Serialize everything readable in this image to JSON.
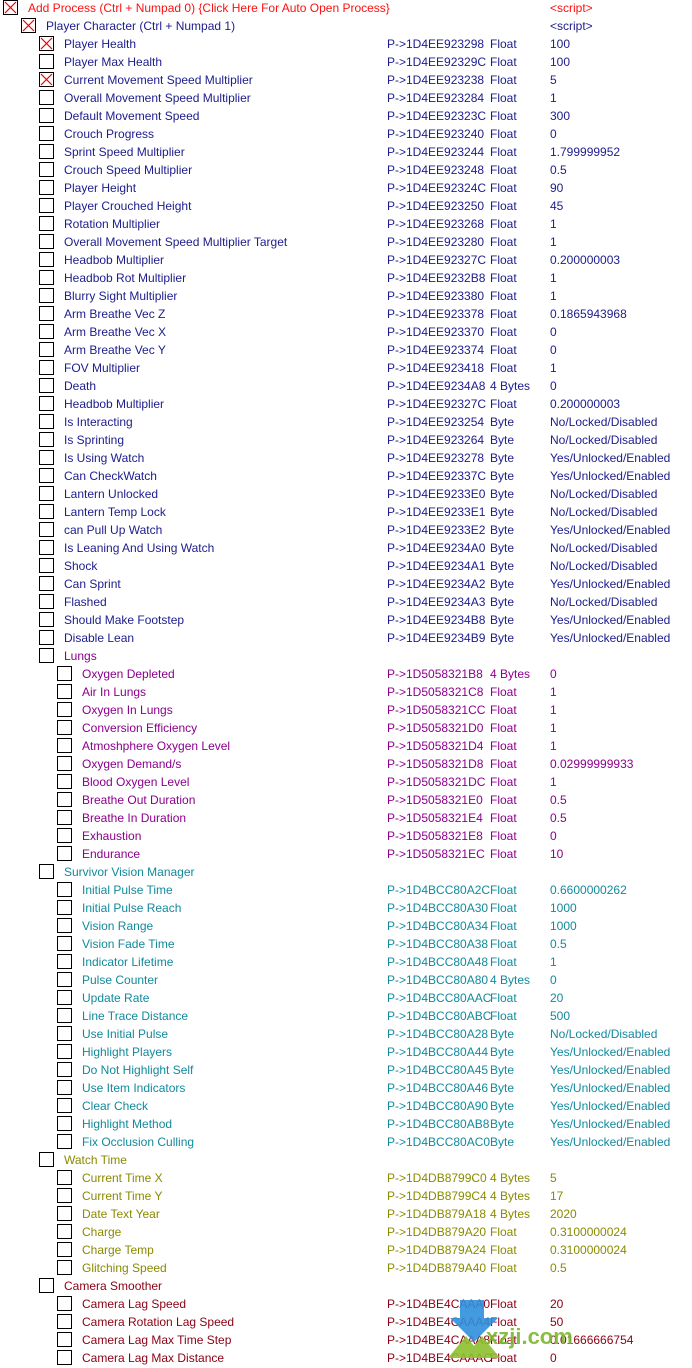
{
  "colors": {
    "red": "#ff1010",
    "navy": "#1c1c8c",
    "purple": "#8c008c",
    "teal": "#128a9c",
    "olive": "#8a8a00",
    "darkred": "#8b0014"
  },
  "rows": [
    {
      "l": 0,
      "c": true,
      "g": "red",
      "name": "Add Process (Ctrl + Numpad 0) {Click Here For Auto Open Process}",
      "addr": "",
      "type": "",
      "value": "<script>"
    },
    {
      "l": 1,
      "c": true,
      "g": "navy",
      "name": "Player Character (Ctrl + Numpad 1)",
      "addr": "",
      "type": "",
      "value": "<script>"
    },
    {
      "l": 2,
      "c": true,
      "g": "navy",
      "name": "Player Health",
      "addr": "P->1D4EE923298",
      "type": "Float",
      "value": "100"
    },
    {
      "l": 2,
      "c": false,
      "g": "navy",
      "name": "Player Max Health",
      "addr": "P->1D4EE92329C",
      "type": "Float",
      "value": "100"
    },
    {
      "l": 2,
      "c": true,
      "g": "navy",
      "name": "Current Movement Speed Multiplier",
      "addr": "P->1D4EE923238",
      "type": "Float",
      "value": "5"
    },
    {
      "l": 2,
      "c": false,
      "g": "navy",
      "name": "Overall Movement Speed Multiplier",
      "addr": "P->1D4EE923284",
      "type": "Float",
      "value": "1"
    },
    {
      "l": 2,
      "c": false,
      "g": "navy",
      "name": "Default Movement Speed",
      "addr": "P->1D4EE92323C",
      "type": "Float",
      "value": "300"
    },
    {
      "l": 2,
      "c": false,
      "g": "navy",
      "name": "Crouch Progress",
      "addr": "P->1D4EE923240",
      "type": "Float",
      "value": "0"
    },
    {
      "l": 2,
      "c": false,
      "g": "navy",
      "name": "Sprint Speed Multiplier",
      "addr": "P->1D4EE923244",
      "type": "Float",
      "value": "1.799999952"
    },
    {
      "l": 2,
      "c": false,
      "g": "navy",
      "name": "Crouch Speed Multiplier",
      "addr": "P->1D4EE923248",
      "type": "Float",
      "value": "0.5"
    },
    {
      "l": 2,
      "c": false,
      "g": "navy",
      "name": "Player Height",
      "addr": "P->1D4EE92324C",
      "type": "Float",
      "value": "90"
    },
    {
      "l": 2,
      "c": false,
      "g": "navy",
      "name": "Player Crouched Height",
      "addr": "P->1D4EE923250",
      "type": "Float",
      "value": "45"
    },
    {
      "l": 2,
      "c": false,
      "g": "navy",
      "name": "Rotation Multiplier",
      "addr": "P->1D4EE923268",
      "type": "Float",
      "value": "1"
    },
    {
      "l": 2,
      "c": false,
      "g": "navy",
      "name": "Overall Movement Speed Multiplier Target",
      "addr": "P->1D4EE923280",
      "type": "Float",
      "value": "1"
    },
    {
      "l": 2,
      "c": false,
      "g": "navy",
      "name": "Headbob Multiplier",
      "addr": "P->1D4EE92327C",
      "type": "Float",
      "value": "0.200000003"
    },
    {
      "l": 2,
      "c": false,
      "g": "navy",
      "name": "Headbob Rot Multiplier",
      "addr": "P->1D4EE9232B8",
      "type": "Float",
      "value": "1"
    },
    {
      "l": 2,
      "c": false,
      "g": "navy",
      "name": "Blurry Sight Multiplier",
      "addr": "P->1D4EE923380",
      "type": "Float",
      "value": "1"
    },
    {
      "l": 2,
      "c": false,
      "g": "navy",
      "name": "Arm Breathe Vec Z",
      "addr": "P->1D4EE923378",
      "type": "Float",
      "value": "0.1865943968"
    },
    {
      "l": 2,
      "c": false,
      "g": "navy",
      "name": "Arm Breathe Vec X",
      "addr": "P->1D4EE923370",
      "type": "Float",
      "value": "0"
    },
    {
      "l": 2,
      "c": false,
      "g": "navy",
      "name": "Arm Breathe Vec Y",
      "addr": "P->1D4EE923374",
      "type": "Float",
      "value": "0"
    },
    {
      "l": 2,
      "c": false,
      "g": "navy",
      "name": "FOV Multiplier",
      "addr": "P->1D4EE923418",
      "type": "Float",
      "value": "1"
    },
    {
      "l": 2,
      "c": false,
      "g": "navy",
      "name": "Death",
      "addr": "P->1D4EE9234A8",
      "type": "4 Bytes",
      "value": "0"
    },
    {
      "l": 2,
      "c": false,
      "g": "navy",
      "name": "Headbob Multiplier",
      "addr": "P->1D4EE92327C",
      "type": "Float",
      "value": "0.200000003"
    },
    {
      "l": 2,
      "c": false,
      "g": "navy",
      "name": "Is Interacting",
      "addr": "P->1D4EE923254",
      "type": "Byte",
      "value": "No/Locked/Disabled"
    },
    {
      "l": 2,
      "c": false,
      "g": "navy",
      "name": "Is Sprinting",
      "addr": "P->1D4EE923264",
      "type": "Byte",
      "value": "No/Locked/Disabled"
    },
    {
      "l": 2,
      "c": false,
      "g": "navy",
      "name": "Is Using Watch",
      "addr": "P->1D4EE923278",
      "type": "Byte",
      "value": "Yes/Unlocked/Enabled"
    },
    {
      "l": 2,
      "c": false,
      "g": "navy",
      "name": "Can CheckWatch",
      "addr": "P->1D4EE92337C",
      "type": "Byte",
      "value": "Yes/Unlocked/Enabled"
    },
    {
      "l": 2,
      "c": false,
      "g": "navy",
      "name": "Lantern Unlocked",
      "addr": "P->1D4EE9233E0",
      "type": "Byte",
      "value": "No/Locked/Disabled"
    },
    {
      "l": 2,
      "c": false,
      "g": "navy",
      "name": "Lantern Temp Lock",
      "addr": "P->1D4EE9233E1",
      "type": "Byte",
      "value": "No/Locked/Disabled"
    },
    {
      "l": 2,
      "c": false,
      "g": "navy",
      "name": "can Pull Up Watch",
      "addr": "P->1D4EE9233E2",
      "type": "Byte",
      "value": "Yes/Unlocked/Enabled"
    },
    {
      "l": 2,
      "c": false,
      "g": "navy",
      "name": "Is Leaning And Using Watch",
      "addr": "P->1D4EE9234A0",
      "type": "Byte",
      "value": "No/Locked/Disabled"
    },
    {
      "l": 2,
      "c": false,
      "g": "navy",
      "name": "Shock",
      "addr": "P->1D4EE9234A1",
      "type": "Byte",
      "value": "No/Locked/Disabled"
    },
    {
      "l": 2,
      "c": false,
      "g": "navy",
      "name": "Can Sprint",
      "addr": "P->1D4EE9234A2",
      "type": "Byte",
      "value": "Yes/Unlocked/Enabled"
    },
    {
      "l": 2,
      "c": false,
      "g": "navy",
      "name": "Flashed",
      "addr": "P->1D4EE9234A3",
      "type": "Byte",
      "value": "No/Locked/Disabled"
    },
    {
      "l": 2,
      "c": false,
      "g": "navy",
      "name": "Should Make Footstep",
      "addr": "P->1D4EE9234B8",
      "type": "Byte",
      "value": "Yes/Unlocked/Enabled"
    },
    {
      "l": 2,
      "c": false,
      "g": "navy",
      "name": "Disable Lean",
      "addr": "P->1D4EE9234B9",
      "type": "Byte",
      "value": "Yes/Unlocked/Enabled"
    },
    {
      "l": 2,
      "c": false,
      "g": "purple",
      "name": "Lungs",
      "addr": "",
      "type": "",
      "value": ""
    },
    {
      "l": 3,
      "c": false,
      "g": "purple",
      "name": "Oxygen Depleted",
      "addr": "P->1D5058321B8",
      "type": "4 Bytes",
      "value": "0"
    },
    {
      "l": 3,
      "c": false,
      "g": "purple",
      "name": "Air In Lungs",
      "addr": "P->1D5058321C8",
      "type": "Float",
      "value": "1"
    },
    {
      "l": 3,
      "c": false,
      "g": "purple",
      "name": "Oxygen In Lungs",
      "addr": "P->1D5058321CC",
      "type": "Float",
      "value": "1"
    },
    {
      "l": 3,
      "c": false,
      "g": "purple",
      "name": "Conversion Efficiency",
      "addr": "P->1D5058321D0",
      "type": "Float",
      "value": "1"
    },
    {
      "l": 3,
      "c": false,
      "g": "purple",
      "name": "Atmoshphere Oxygen Level",
      "addr": "P->1D5058321D4",
      "type": "Float",
      "value": "1"
    },
    {
      "l": 3,
      "c": false,
      "g": "purple",
      "name": "Oxygen Demand/s",
      "addr": "P->1D5058321D8",
      "type": "Float",
      "value": "0.02999999933"
    },
    {
      "l": 3,
      "c": false,
      "g": "purple",
      "name": "Blood Oxygen Level",
      "addr": "P->1D5058321DC",
      "type": "Float",
      "value": "1"
    },
    {
      "l": 3,
      "c": false,
      "g": "purple",
      "name": "Breathe Out Duration",
      "addr": "P->1D5058321E0",
      "type": "Float",
      "value": "0.5"
    },
    {
      "l": 3,
      "c": false,
      "g": "purple",
      "name": "Breathe In Duration",
      "addr": "P->1D5058321E4",
      "type": "Float",
      "value": "0.5"
    },
    {
      "l": 3,
      "c": false,
      "g": "purple",
      "name": "Exhaustion",
      "addr": "P->1D5058321E8",
      "type": "Float",
      "value": "0"
    },
    {
      "l": 3,
      "c": false,
      "g": "purple",
      "name": "Endurance",
      "addr": "P->1D5058321EC",
      "type": "Float",
      "value": "10"
    },
    {
      "l": 2,
      "c": false,
      "g": "teal",
      "name": "Survivor Vision Manager",
      "addr": "",
      "type": "",
      "value": ""
    },
    {
      "l": 3,
      "c": false,
      "g": "teal",
      "name": "Initial Pulse Time",
      "addr": "P->1D4BCC80A2C",
      "type": "Float",
      "value": "0.6600000262"
    },
    {
      "l": 3,
      "c": false,
      "g": "teal",
      "name": "Initial Pulse Reach",
      "addr": "P->1D4BCC80A30",
      "type": "Float",
      "value": "1000"
    },
    {
      "l": 3,
      "c": false,
      "g": "teal",
      "name": "Vision Range",
      "addr": "P->1D4BCC80A34",
      "type": "Float",
      "value": "1000"
    },
    {
      "l": 3,
      "c": false,
      "g": "teal",
      "name": "Vision Fade Time",
      "addr": "P->1D4BCC80A38",
      "type": "Float",
      "value": "0.5"
    },
    {
      "l": 3,
      "c": false,
      "g": "teal",
      "name": "Indicator Lifetime",
      "addr": "P->1D4BCC80A48",
      "type": "Float",
      "value": "1"
    },
    {
      "l": 3,
      "c": false,
      "g": "teal",
      "name": "Pulse Counter",
      "addr": "P->1D4BCC80A80",
      "type": "4 Bytes",
      "value": "0"
    },
    {
      "l": 3,
      "c": false,
      "g": "teal",
      "name": "Update Rate",
      "addr": "P->1D4BCC80AAC",
      "type": "Float",
      "value": "20"
    },
    {
      "l": 3,
      "c": false,
      "g": "teal",
      "name": "Line Trace Distance",
      "addr": "P->1D4BCC80ABC",
      "type": "Float",
      "value": "500"
    },
    {
      "l": 3,
      "c": false,
      "g": "teal",
      "name": "Use Initial Pulse",
      "addr": "P->1D4BCC80A28",
      "type": "Byte",
      "value": "No/Locked/Disabled"
    },
    {
      "l": 3,
      "c": false,
      "g": "teal",
      "name": "Highlight Players",
      "addr": "P->1D4BCC80A44",
      "type": "Byte",
      "value": "Yes/Unlocked/Enabled"
    },
    {
      "l": 3,
      "c": false,
      "g": "teal",
      "name": "Do Not Highlight Self",
      "addr": "P->1D4BCC80A45",
      "type": "Byte",
      "value": "Yes/Unlocked/Enabled"
    },
    {
      "l": 3,
      "c": false,
      "g": "teal",
      "name": "Use Item Indicators",
      "addr": "P->1D4BCC80A46",
      "type": "Byte",
      "value": "Yes/Unlocked/Enabled"
    },
    {
      "l": 3,
      "c": false,
      "g": "teal",
      "name": "Clear Check",
      "addr": "P->1D4BCC80A90",
      "type": "Byte",
      "value": "Yes/Unlocked/Enabled"
    },
    {
      "l": 3,
      "c": false,
      "g": "teal",
      "name": "Highlight Method",
      "addr": "P->1D4BCC80AB8",
      "type": "Byte",
      "value": "Yes/Unlocked/Enabled"
    },
    {
      "l": 3,
      "c": false,
      "g": "teal",
      "name": "Fix Occlusion Culling",
      "addr": "P->1D4BCC80AC0",
      "type": "Byte",
      "value": "Yes/Unlocked/Enabled"
    },
    {
      "l": 2,
      "c": false,
      "g": "olive",
      "name": "Watch Time",
      "addr": "",
      "type": "",
      "value": ""
    },
    {
      "l": 3,
      "c": false,
      "g": "olive",
      "name": "Current Time X",
      "addr": "P->1D4DB8799C0",
      "type": "4 Bytes",
      "value": "5"
    },
    {
      "l": 3,
      "c": false,
      "g": "olive",
      "name": "Current Time Y",
      "addr": "P->1D4DB8799C4",
      "type": "4 Bytes",
      "value": "17"
    },
    {
      "l": 3,
      "c": false,
      "g": "olive",
      "name": "Date Text Year",
      "addr": "P->1D4DB879A18",
      "type": "4 Bytes",
      "value": "2020"
    },
    {
      "l": 3,
      "c": false,
      "g": "olive",
      "name": "Charge",
      "addr": "P->1D4DB879A20",
      "type": "Float",
      "value": "0.3100000024"
    },
    {
      "l": 3,
      "c": false,
      "g": "olive",
      "name": "Charge Temp",
      "addr": "P->1D4DB879A24",
      "type": "Float",
      "value": "0.3100000024"
    },
    {
      "l": 3,
      "c": false,
      "g": "olive",
      "name": "Glitching Speed",
      "addr": "P->1D4DB879A40",
      "type": "Float",
      "value": "0.5"
    },
    {
      "l": 2,
      "c": false,
      "g": "darkred",
      "name": "Camera Smoother",
      "addr": "",
      "type": "",
      "value": ""
    },
    {
      "l": 3,
      "c": false,
      "g": "darkred",
      "name": "Camera Lag Speed",
      "addr": "P->1D4BE4CAAA0",
      "type": "Float",
      "value": "20"
    },
    {
      "l": 3,
      "c": false,
      "g": "darkred",
      "name": "Camera Rotation Lag Speed",
      "addr": "P->1D4BE4CAAA4",
      "type": "Float",
      "value": "50"
    },
    {
      "l": 3,
      "c": false,
      "g": "darkred",
      "name": "Camera Lag Max Time Step",
      "addr": "P->1D4BE4CAAA8",
      "type": "Float",
      "value": "0.01666666754"
    },
    {
      "l": 3,
      "c": false,
      "g": "darkred",
      "name": "Camera Lag Max Distance",
      "addr": "P->1D4BE4CAAAC",
      "type": "Float",
      "value": "0"
    }
  ],
  "watermark": {
    "logo_text": "下载集",
    "site": "xzji.com"
  }
}
